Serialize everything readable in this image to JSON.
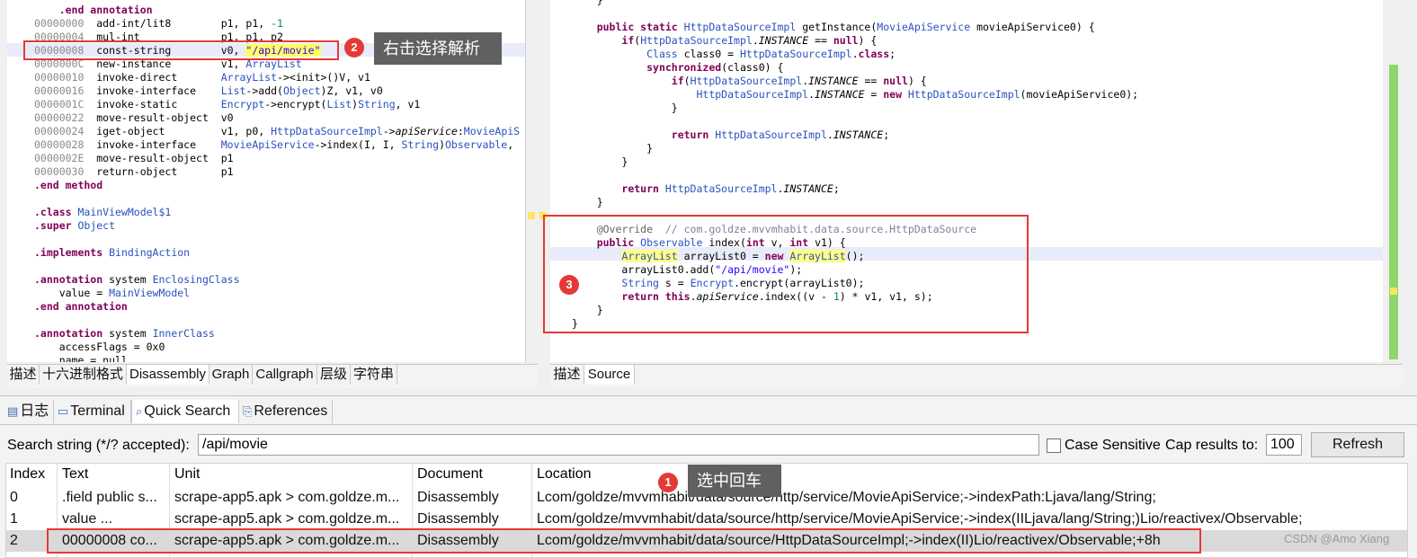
{
  "disasm": {
    "lines": [
      [
        {
          "t": "    .end annotation",
          "c": "kw"
        }
      ],
      [
        {
          "t": "00000000",
          "c": "addr"
        },
        {
          "t": "  add-int/lit8        p1, p1, "
        },
        {
          "t": "-1",
          "c": "num"
        }
      ],
      [
        {
          "t": "00000004",
          "c": "addr"
        },
        {
          "t": "  mul-int             p1, p1, p2"
        }
      ],
      [
        {
          "t": "00000008",
          "c": "addr"
        },
        {
          "t": "  const-string        v0, "
        },
        {
          "t": "\"/api/movie\"",
          "c": "str hl-str"
        }
      ],
      [
        {
          "t": "0000000C",
          "c": "addr"
        },
        {
          "t": "  new-instance        v1, "
        },
        {
          "t": "ArrayList",
          "c": "ty"
        }
      ],
      [
        {
          "t": "00000010",
          "c": "addr"
        },
        {
          "t": "  invoke-direct       "
        },
        {
          "t": "ArrayList",
          "c": "ty"
        },
        {
          "t": "-><init>()V, v1"
        }
      ],
      [
        {
          "t": "00000016",
          "c": "addr"
        },
        {
          "t": "  invoke-interface    "
        },
        {
          "t": "List",
          "c": "ty"
        },
        {
          "t": "->add("
        },
        {
          "t": "Object",
          "c": "ty"
        },
        {
          "t": ")Z, v1, v0"
        }
      ],
      [
        {
          "t": "0000001C",
          "c": "addr"
        },
        {
          "t": "  invoke-static       "
        },
        {
          "t": "Encrypt",
          "c": "ty"
        },
        {
          "t": "->encrypt("
        },
        {
          "t": "List",
          "c": "ty"
        },
        {
          "t": ")"
        },
        {
          "t": "String",
          "c": "ty"
        },
        {
          "t": ", v1"
        }
      ],
      [
        {
          "t": "00000022",
          "c": "addr"
        },
        {
          "t": "  move-result-object  v0"
        }
      ],
      [
        {
          "t": "00000024",
          "c": "addr"
        },
        {
          "t": "  iget-object         v1, p0, "
        },
        {
          "t": "HttpDataSourceImpl",
          "c": "ty"
        },
        {
          "t": "->"
        },
        {
          "t": "apiService",
          "c": "it"
        },
        {
          "t": ":"
        },
        {
          "t": "MovieApiS",
          "c": "ty"
        }
      ],
      [
        {
          "t": "00000028",
          "c": "addr"
        },
        {
          "t": "  invoke-interface    "
        },
        {
          "t": "MovieApiService",
          "c": "ty"
        },
        {
          "t": "->index(I, I, "
        },
        {
          "t": "String",
          "c": "ty"
        },
        {
          "t": ")"
        },
        {
          "t": "Observable",
          "c": "ty"
        },
        {
          "t": ","
        }
      ],
      [
        {
          "t": "0000002E",
          "c": "addr"
        },
        {
          "t": "  move-result-object  p1"
        }
      ],
      [
        {
          "t": "00000030",
          "c": "addr"
        },
        {
          "t": "  return-object       p1"
        }
      ],
      [
        {
          "t": ".end method",
          "c": "kw"
        }
      ],
      [
        {
          "t": ""
        }
      ],
      [
        {
          "t": ".class ",
          "c": "kw"
        },
        {
          "t": "MainViewModel$1",
          "c": "ty"
        }
      ],
      [
        {
          "t": ".super ",
          "c": "kw"
        },
        {
          "t": "Object",
          "c": "ty"
        }
      ],
      [
        {
          "t": ""
        }
      ],
      [
        {
          "t": ".implements ",
          "c": "kw"
        },
        {
          "t": "BindingAction",
          "c": "ty"
        }
      ],
      [
        {
          "t": ""
        }
      ],
      [
        {
          "t": ".annotation ",
          "c": "kw"
        },
        {
          "t": "system "
        },
        {
          "t": "EnclosingClass",
          "c": "ty"
        }
      ],
      [
        {
          "t": "    value = "
        },
        {
          "t": "MainViewModel",
          "c": "ty"
        }
      ],
      [
        {
          "t": ".end annotation",
          "c": "kw"
        }
      ],
      [
        {
          "t": ""
        }
      ],
      [
        {
          "t": ".annotation ",
          "c": "kw"
        },
        {
          "t": "system "
        },
        {
          "t": "InnerClass",
          "c": "ty"
        }
      ],
      [
        {
          "t": "    accessFlags = 0x0"
        }
      ],
      [
        {
          "t": "    name = null"
        }
      ]
    ],
    "tabs": [
      "描述",
      "十六进制格式",
      "Disassembly",
      "Graph",
      "Callgraph",
      "层级",
      "字符串"
    ],
    "active_tab": 2
  },
  "source": {
    "lines": [
      [
        {
          "t": "    }"
        }
      ],
      [
        {
          "t": ""
        }
      ],
      [
        {
          "t": "    "
        },
        {
          "t": "public static ",
          "c": "kw"
        },
        {
          "t": "HttpDataSourceImpl",
          "c": "ty"
        },
        {
          "t": " getInstance("
        },
        {
          "t": "MovieApiService",
          "c": "ty"
        },
        {
          "t": " movieApiService0) {"
        }
      ],
      [
        {
          "t": "        "
        },
        {
          "t": "if",
          "c": "kw"
        },
        {
          "t": "("
        },
        {
          "t": "HttpDataSourceImpl",
          "c": "ty"
        },
        {
          "t": "."
        },
        {
          "t": "INSTANCE",
          "c": "it"
        },
        {
          "t": " == "
        },
        {
          "t": "null",
          "c": "kw"
        },
        {
          "t": ") {"
        }
      ],
      [
        {
          "t": "            "
        },
        {
          "t": "Class",
          "c": "ty"
        },
        {
          "t": " class0 = "
        },
        {
          "t": "HttpDataSourceImpl",
          "c": "ty"
        },
        {
          "t": "."
        },
        {
          "t": "class",
          "c": "kw"
        },
        {
          "t": ";"
        }
      ],
      [
        {
          "t": "            "
        },
        {
          "t": "synchronized",
          "c": "kw"
        },
        {
          "t": "(class0) {"
        }
      ],
      [
        {
          "t": "                "
        },
        {
          "t": "if",
          "c": "kw"
        },
        {
          "t": "("
        },
        {
          "t": "HttpDataSourceImpl",
          "c": "ty"
        },
        {
          "t": "."
        },
        {
          "t": "INSTANCE",
          "c": "it"
        },
        {
          "t": " == "
        },
        {
          "t": "null",
          "c": "kw"
        },
        {
          "t": ") {"
        }
      ],
      [
        {
          "t": "                    "
        },
        {
          "t": "HttpDataSourceImpl",
          "c": "ty"
        },
        {
          "t": "."
        },
        {
          "t": "INSTANCE",
          "c": "it"
        },
        {
          "t": " = "
        },
        {
          "t": "new ",
          "c": "kw"
        },
        {
          "t": "HttpDataSourceImpl",
          "c": "ty"
        },
        {
          "t": "(movieApiService0);"
        }
      ],
      [
        {
          "t": "                }"
        }
      ],
      [
        {
          "t": ""
        }
      ],
      [
        {
          "t": "                "
        },
        {
          "t": "return ",
          "c": "kw"
        },
        {
          "t": "HttpDataSourceImpl",
          "c": "ty"
        },
        {
          "t": "."
        },
        {
          "t": "INSTANCE",
          "c": "it"
        },
        {
          "t": ";"
        }
      ],
      [
        {
          "t": "            }"
        }
      ],
      [
        {
          "t": "        }"
        }
      ],
      [
        {
          "t": ""
        }
      ],
      [
        {
          "t": "        "
        },
        {
          "t": "return ",
          "c": "kw"
        },
        {
          "t": "HttpDataSourceImpl",
          "c": "ty"
        },
        {
          "t": "."
        },
        {
          "t": "INSTANCE",
          "c": "it"
        },
        {
          "t": ";"
        }
      ],
      [
        {
          "t": "    }"
        }
      ],
      [
        {
          "t": ""
        }
      ],
      [
        {
          "t": "    "
        },
        {
          "t": "@Override",
          "c": "ann"
        },
        {
          "t": "  // com.goldze.mvvmhabit.data.source.HttpDataSource",
          "c": "com"
        }
      ],
      [
        {
          "t": "    "
        },
        {
          "t": "public ",
          "c": "kw"
        },
        {
          "t": "Observable",
          "c": "ty"
        },
        {
          "t": " index("
        },
        {
          "t": "int ",
          "c": "kw"
        },
        {
          "t": "v, "
        },
        {
          "t": "int ",
          "c": "kw"
        },
        {
          "t": "v1) {"
        }
      ],
      [
        {
          "t": "        "
        },
        {
          "t": "ArrayList",
          "c": "ty hl-yel"
        },
        {
          "t": " arrayList0 = "
        },
        {
          "t": "new ",
          "c": "kw"
        },
        {
          "t": "ArrayList",
          "c": "ty hl-yel"
        },
        {
          "t": "();"
        }
      ],
      [
        {
          "t": "        arrayList0.add("
        },
        {
          "t": "\"/api/movie\"",
          "c": "str"
        },
        {
          "t": ");"
        }
      ],
      [
        {
          "t": "        "
        },
        {
          "t": "String",
          "c": "ty"
        },
        {
          "t": " s = "
        },
        {
          "t": "Encrypt",
          "c": "ty"
        },
        {
          "t": ".encrypt(arrayList0);"
        }
      ],
      [
        {
          "t": "        "
        },
        {
          "t": "return ",
          "c": "kw"
        },
        {
          "t": "this",
          "c": "kw"
        },
        {
          "t": "."
        },
        {
          "t": "apiService",
          "c": "it"
        },
        {
          "t": ".index((v - "
        },
        {
          "t": "1",
          "c": "num"
        },
        {
          "t": ") * v1, v1, s);"
        }
      ],
      [
        {
          "t": "    }"
        }
      ],
      [
        {
          "t": "}"
        }
      ]
    ],
    "tabs": [
      "描述",
      "Source"
    ],
    "active_tab": 1
  },
  "bottom": {
    "tabs": [
      {
        "label": "日志",
        "icon": "log-icon"
      },
      {
        "label": "Terminal",
        "icon": "terminal-icon"
      },
      {
        "label": "Quick Search",
        "icon": "search-icon"
      },
      {
        "label": "References",
        "icon": "references-icon"
      }
    ],
    "active_tab": 2,
    "search_label": "Search string (*/? accepted):",
    "search_value": "/api/movie",
    "case_sensitive_label": "Case Sensitive",
    "case_sensitive_checked": false,
    "cap_label": "Cap results to:",
    "cap_value": "100",
    "refresh_label": "Refresh",
    "columns": [
      "Index",
      "Text",
      "Unit",
      "Document",
      "Location"
    ],
    "rows": [
      {
        "index": "0",
        "text": ".field public s...",
        "unit": "scrape-app5.apk > com.goldze.m...",
        "document": "Disassembly",
        "location": "Lcom/goldze/mvvmhabit/data/source/http/service/MovieApiService;->indexPath:Ljava/lang/String;"
      },
      {
        "index": "1",
        "text": "          value ...",
        "unit": "scrape-app5.apk > com.goldze.m...",
        "document": "Disassembly",
        "location": "Lcom/goldze/mvvmhabit/data/source/http/service/MovieApiService;->index(IILjava/lang/String;)Lio/reactivex/Observable;"
      },
      {
        "index": "2",
        "text": "00000008  co...",
        "unit": "scrape-app5.apk > com.goldze.m...",
        "document": "Disassembly",
        "location": "Lcom/goldze/mvvmhabit/data/source/HttpDataSourceImpl;->index(II)Lio/reactivex/Observable;+8h"
      }
    ],
    "selected_row": 2
  },
  "annotations": {
    "step1": {
      "num": "1",
      "text": "选中回车"
    },
    "step2": {
      "num": "2",
      "text": "右击选择解析"
    },
    "step3": {
      "num": "3"
    },
    "accent": "#e53935"
  },
  "watermark": "CSDN @Amo Xiang"
}
